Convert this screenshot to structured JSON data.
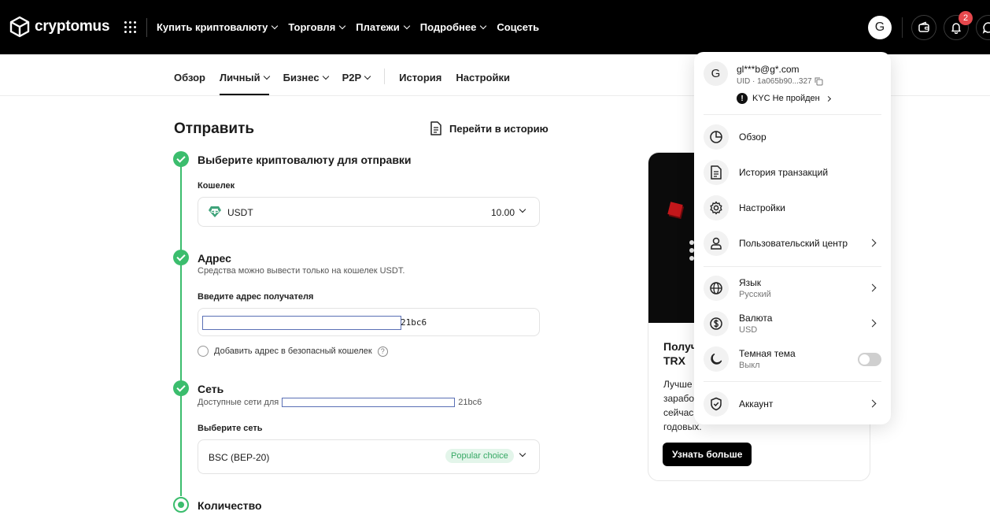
{
  "header": {
    "brand": "cryptomus",
    "nav": [
      {
        "label": "Купить криптовалюту",
        "dropdown": true
      },
      {
        "label": "Торговля",
        "dropdown": true
      },
      {
        "label": "Платежи",
        "dropdown": true
      },
      {
        "label": "Подробнее",
        "dropdown": true
      },
      {
        "label": "Соцсеть",
        "dropdown": false
      }
    ],
    "avatar_letter": "G",
    "notifications_count": "2"
  },
  "subnav": {
    "tabs": [
      {
        "label": "Обзор"
      },
      {
        "label": "Личный",
        "active": true
      },
      {
        "label": "Бизнес"
      },
      {
        "label": "P2P"
      },
      {
        "label": "История"
      },
      {
        "label": "Настройки"
      }
    ]
  },
  "send": {
    "title": "Отправить",
    "history_link": "Перейти в историю",
    "step1": {
      "title": "Выберите криптовалюту для отправки",
      "wallet_label": "Кошелек",
      "currency": "USDT",
      "balance": "10.00"
    },
    "step2": {
      "title": "Адрес",
      "hint": "Средства можно вывести только на кошелек USDT.",
      "address_label": "Введите адрес получателя",
      "address_suffix": "21bc6",
      "safe_wallet_label": "Добавить адрес в безопасный кошелек"
    },
    "step3": {
      "title": "Сеть",
      "hint_prefix": "Доступные сети для",
      "hint_suffix": "21bc6",
      "network_label": "Выберите сеть",
      "network_value": "BSC (BEP-20)",
      "badge": "Popular choice"
    },
    "step4": {
      "title": "Количество"
    }
  },
  "promo": {
    "title": "Получ\nTRX",
    "text": "Лучше\nзарабо\nсейчас\nгодовых.",
    "button": "Узнать больше"
  },
  "account_menu": {
    "avatar_letter": "G",
    "email": "gl***b@g*.com",
    "uid": "UID · 1a065b90...327",
    "kyc": "KYC Не пройден",
    "items": [
      {
        "label": "Обзор",
        "icon": "pie-chart-icon"
      },
      {
        "label": "История транзакций",
        "icon": "document-icon"
      },
      {
        "label": "Настройки",
        "icon": "gear-icon"
      },
      {
        "label": "Пользовательский центр",
        "icon": "user-icon"
      }
    ],
    "language": {
      "label": "Язык",
      "value": "Русский"
    },
    "currency": {
      "label": "Валюта",
      "value": "USD"
    },
    "theme": {
      "label": "Темная тема",
      "value": "Выкл"
    },
    "account": {
      "label": "Аккаунт"
    }
  },
  "colors": {
    "accent_green": "#3bbd6d",
    "header_bg": "#000000",
    "badge_red": "#e5484d"
  }
}
